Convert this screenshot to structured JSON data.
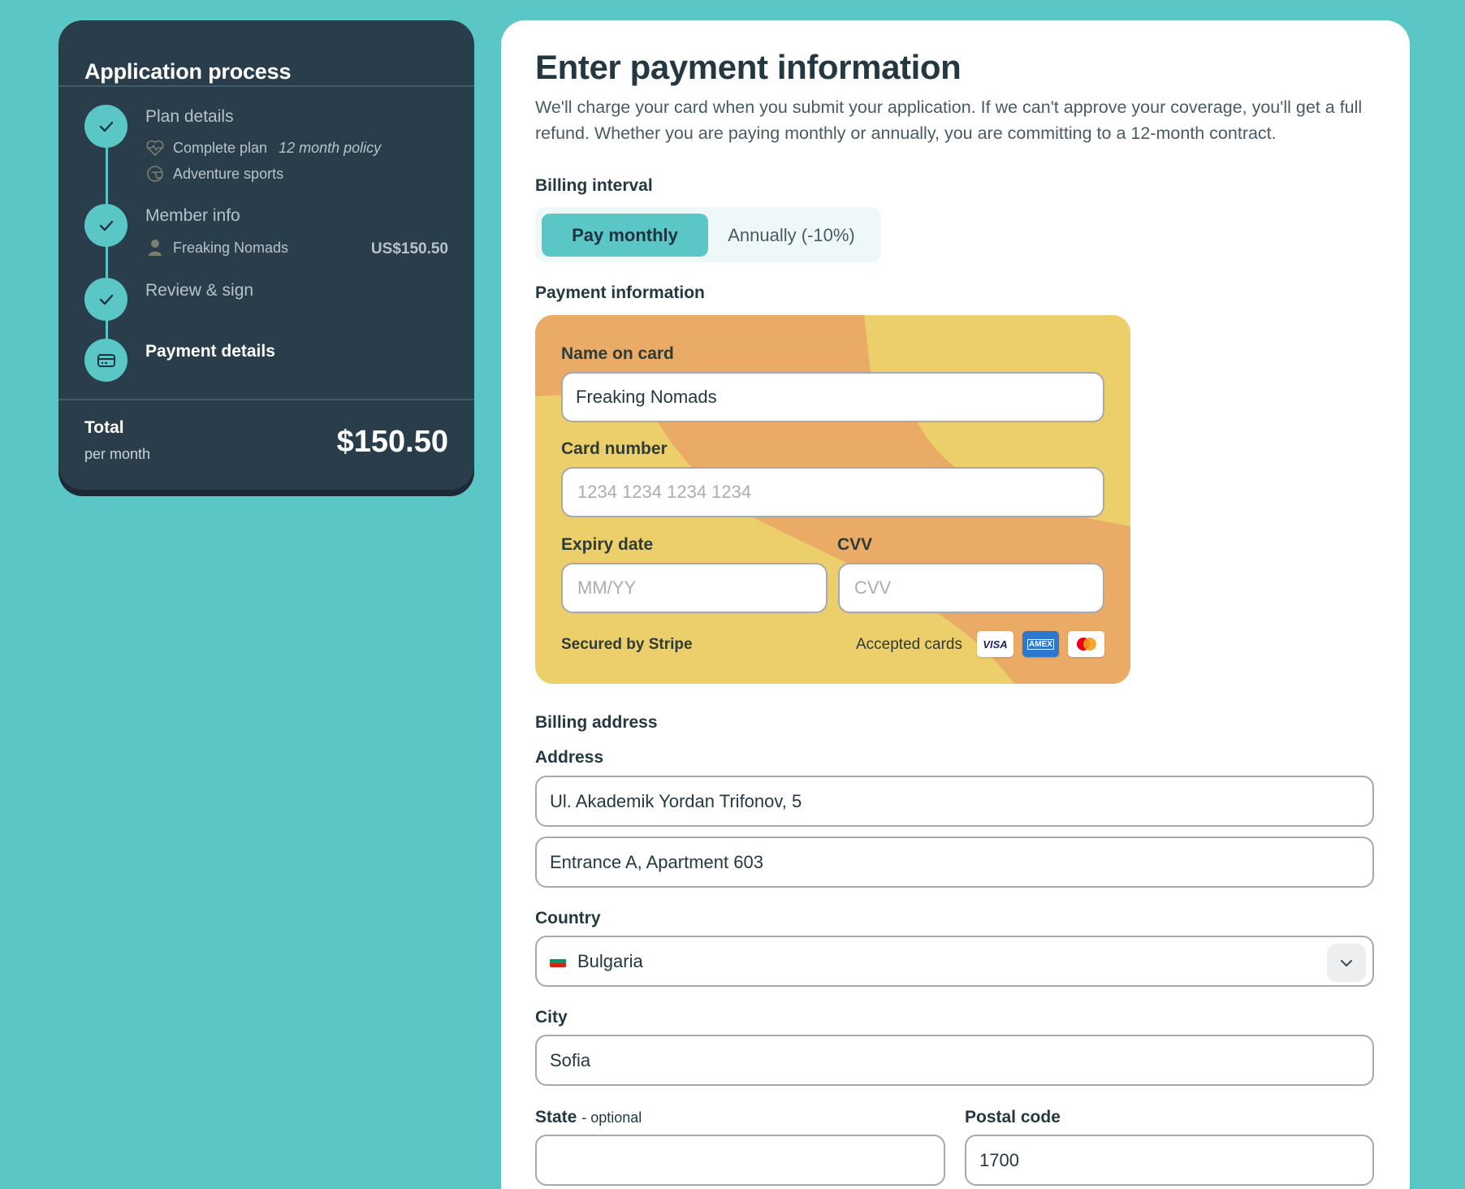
{
  "sidebar": {
    "title": "Application process",
    "steps": [
      {
        "title": "Plan details",
        "status": "completed",
        "details": [
          {
            "icon": "heart-pulse-icon",
            "text": "Complete plan",
            "note": "12 month policy"
          },
          {
            "icon": "helmet-icon",
            "text": "Adventure sports"
          }
        ]
      },
      {
        "title": "Member info",
        "status": "completed",
        "details": [
          {
            "icon": "person-icon",
            "text": "Freaking Nomads",
            "amount": "US$150.50"
          }
        ]
      },
      {
        "title": "Review & sign",
        "status": "completed"
      },
      {
        "title": "Payment details",
        "status": "current",
        "icon": "credit-card-icon"
      }
    ],
    "total": {
      "label": "Total",
      "period": "per month",
      "amount": "$150.50"
    }
  },
  "main": {
    "title": "Enter payment information",
    "intro": "We'll charge your card when you submit your application. If we can't approve your coverage, you'll get a full refund. Whether you are paying monthly or annually, you are committing to a 12-month contract.",
    "billing_interval": {
      "label": "Billing interval",
      "options": [
        "Pay monthly",
        "Annually (-10%)"
      ],
      "selected": "Pay monthly"
    },
    "payment": {
      "label": "Payment information",
      "name_label": "Name on card",
      "name_value": "Freaking Nomads",
      "number_label": "Card number",
      "number_placeholder": "1234 1234 1234 1234",
      "expiry_label": "Expiry date",
      "expiry_placeholder": "MM/YY",
      "cvv_label": "CVV",
      "cvv_placeholder": "CVV",
      "secured_text": "Secured by Stripe",
      "accepted_label": "Accepted cards",
      "brands": [
        "VISA",
        "AMEX",
        "Mastercard"
      ]
    },
    "billing_address": {
      "label": "Billing address",
      "address_label": "Address",
      "address_line1": "Ul. Akademik Yordan Trifonov, 5",
      "address_line2": "Entrance A, Apartment 603",
      "country_label": "Country",
      "country_value": "Bulgaria",
      "city_label": "City",
      "city_value": "Sofia",
      "state_label": "State",
      "state_optional": "- optional",
      "state_value": "",
      "postal_label": "Postal code",
      "postal_value": "1700"
    }
  },
  "colors": {
    "background": "#5bc6c6",
    "sidebar": "#293d4a",
    "accent": "#5bc6c6",
    "card_yellow": "#eccf6a",
    "card_orange": "#eaab67"
  }
}
